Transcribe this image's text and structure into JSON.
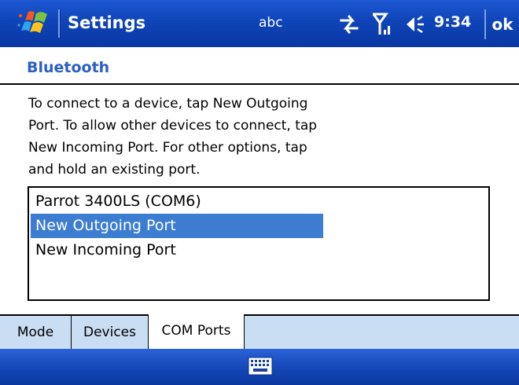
{
  "title_bar": {
    "app_title": "Settings",
    "input_mode": "abc",
    "clock": "9:34",
    "ok_label": "ok",
    "icons": [
      "windows-start-icon",
      "connectivity-icon",
      "signal-strength-icon",
      "volume-icon"
    ]
  },
  "page": {
    "title": "Bluetooth",
    "instructions": [
      "To connect to a device, tap New Outgoing",
      "Port. To allow other devices to connect, tap",
      "New Incoming Port. For other options, tap",
      "and hold an existing port."
    ]
  },
  "port_list": {
    "items": [
      {
        "label": "Parrot 3400LS (COM6)",
        "selected": false
      },
      {
        "label": "New Outgoing Port",
        "selected": true
      },
      {
        "label": "New Incoming Port",
        "selected": false
      }
    ]
  },
  "tabs": [
    {
      "label": "Mode",
      "active": false
    },
    {
      "label": "Devices",
      "active": false
    },
    {
      "label": "COM Ports",
      "active": true
    }
  ],
  "menu_bar": {
    "icons": [
      "keyboard-icon"
    ]
  },
  "colors": {
    "title_bar": "#0f44b8",
    "page_title": "#2b5fc8",
    "selection": "#3d7dd1",
    "tab_strip": "#c9ddf3"
  }
}
